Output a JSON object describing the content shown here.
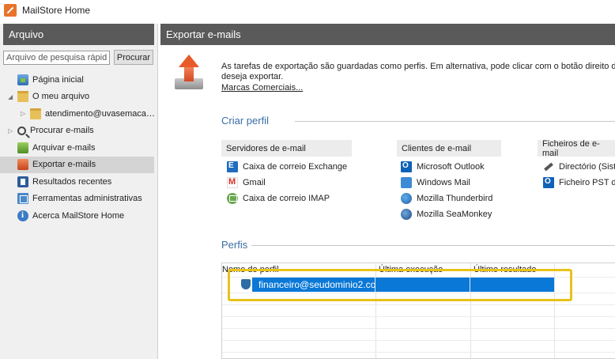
{
  "window": {
    "title": "MailStore Home"
  },
  "colors": {
    "header_bg": "#5a5a5a",
    "accent": "#3a6ea5",
    "selection": "#0a78d7",
    "highlight": "#e8c21a"
  },
  "sidebar": {
    "header": "Arquivo",
    "search": {
      "placeholder": "Arquivo de pesquisa rápida",
      "button": "Procurar"
    },
    "items": [
      {
        "label": "Página inicial",
        "icon": "home-icon"
      },
      {
        "label": "O meu arquivo",
        "icon": "folder-icon",
        "expanded": true
      },
      {
        "label": "atendimento@uvasemacas....",
        "icon": "folder-icon"
      },
      {
        "label": "Procurar e-mails",
        "icon": "search-icon"
      },
      {
        "label": "Arquivar e-mails",
        "icon": "archive-icon"
      },
      {
        "label": "Exportar e-mails",
        "icon": "export-icon",
        "selected": true
      },
      {
        "label": "Resultados recentes",
        "icon": "recent-results-icon"
      },
      {
        "label": "Ferramentas administrativas",
        "icon": "admin-tools-icon"
      },
      {
        "label": "Acerca MailStore Home",
        "icon": "about-icon"
      }
    ]
  },
  "main": {
    "header": "Exportar e-mails",
    "intro_line1": "As tarefas de exportação são guardadas como perfis. Em alternativa, pode clicar com o botão direito do ra",
    "intro_line2": "deseja exportar.",
    "link": "Marcas Comerciais...",
    "create_profile": {
      "title": "Criar perfil",
      "columns": [
        {
          "header": "Servidores de e-mail",
          "items": [
            {
              "label": "Caixa de correio Exchange",
              "icon": "exchange-icon"
            },
            {
              "label": "Gmail",
              "icon": "gmail-icon"
            },
            {
              "label": "Caixa de correio IMAP",
              "icon": "imap-icon"
            }
          ]
        },
        {
          "header": "Clientes de e-mail",
          "items": [
            {
              "label": "Microsoft Outlook",
              "icon": "outlook-icon"
            },
            {
              "label": "Windows Mail",
              "icon": "windows-mail-icon"
            },
            {
              "label": "Mozilla Thunderbird",
              "icon": "thunderbird-icon"
            },
            {
              "label": "Mozilla SeaMonkey",
              "icon": "seamonkey-icon"
            }
          ]
        },
        {
          "header": "Ficheiros de e-mail",
          "items": [
            {
              "label": "Directório (Siste",
              "icon": "directory-icon"
            },
            {
              "label": "Ficheiro PST do",
              "icon": "pst-icon"
            }
          ]
        }
      ]
    },
    "profiles": {
      "title": "Perfis",
      "columns": [
        "Nome do perfil",
        "Última execução",
        "Último resultado"
      ],
      "rows": [
        {
          "name": "financeiro@seudominio2.co",
          "last_run": "",
          "last_result": ""
        }
      ]
    }
  }
}
